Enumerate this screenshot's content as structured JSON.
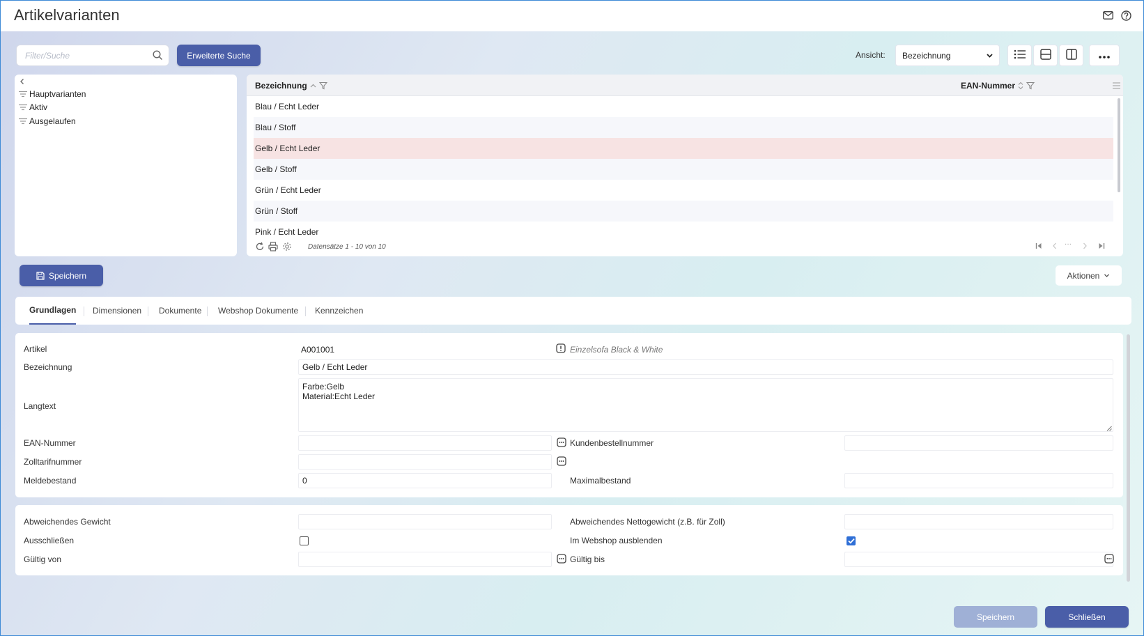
{
  "window": {
    "title": "Artikelvarianten"
  },
  "toolbar": {
    "search_placeholder": "Filter/Suche",
    "advanced_search_label": "Erweiterte Suche",
    "view_label": "Ansicht:",
    "view_selected": "Bezeichnung"
  },
  "tree": {
    "items": [
      {
        "label": "Hauptvarianten"
      },
      {
        "label": "Aktiv"
      },
      {
        "label": "Ausgelaufen"
      }
    ]
  },
  "grid": {
    "columns": [
      {
        "label": "Bezeichnung"
      },
      {
        "label": "EAN-Nummer"
      }
    ],
    "rows": [
      {
        "bezeichnung": "Blau / Echt Leder"
      },
      {
        "bezeichnung": "Blau / Stoff"
      },
      {
        "bezeichnung": "Gelb / Echt Leder",
        "selected": true
      },
      {
        "bezeichnung": "Gelb / Stoff"
      },
      {
        "bezeichnung": "Grün / Echt Leder"
      },
      {
        "bezeichnung": "Grün / Stoff"
      },
      {
        "bezeichnung": "Pink / Echt Leder"
      }
    ],
    "records_text": "Datensätze 1 - 10 von 10",
    "pager_ellipsis": "···"
  },
  "actions": {
    "save_label": "Speichern",
    "aktionen_label": "Aktionen"
  },
  "tabs": [
    {
      "label": "Grundlagen",
      "active": true
    },
    {
      "label": "Dimensionen"
    },
    {
      "label": "Dokumente"
    },
    {
      "label": "Webshop Dokumente"
    },
    {
      "label": "Kennzeichen"
    }
  ],
  "form": {
    "artikel_label": "Artikel",
    "artikel_value": "A001001",
    "artikel_desc": "Einzelsofa Black & White",
    "bezeichnung_label": "Bezeichnung",
    "bezeichnung_value": "Gelb / Echt Leder",
    "langtext_label": "Langtext",
    "langtext_value": "Farbe:Gelb\nMaterial:Echt Leder",
    "ean_label": "EAN-Nummer",
    "ean_value": "",
    "kundenbestellnummer_label": "Kundenbestellnummer",
    "kundenbestellnummer_value": "",
    "zolltarif_label": "Zolltarifnummer",
    "zolltarif_value": "",
    "meldebestand_label": "Meldebestand",
    "meldebestand_value": "0",
    "maximalbestand_label": "Maximalbestand",
    "maximalbestand_value": "",
    "abw_gewicht_label": "Abweichendes Gewicht",
    "abw_gewicht_value": "",
    "abw_netto_label": "Abweichendes Nettogewicht (z.B. für Zoll)",
    "abw_netto_value": "",
    "ausschliessen_label": "Ausschließen",
    "ausschliessen_checked": false,
    "webshop_label": "Im Webshop ausblenden",
    "webshop_checked": true,
    "gueltig_von_label": "Gültig von",
    "gueltig_von_value": "",
    "gueltig_bis_label": "Gültig bis",
    "gueltig_bis_value": ""
  },
  "footer": {
    "save_label": "Speichern",
    "close_label": "Schließen"
  },
  "colors": {
    "primary": "#4a5ea8",
    "primary_disabled": "#9fb0d6",
    "selected_row": "#f7e3e3",
    "checkbox_checked": "#2f6fd6"
  }
}
